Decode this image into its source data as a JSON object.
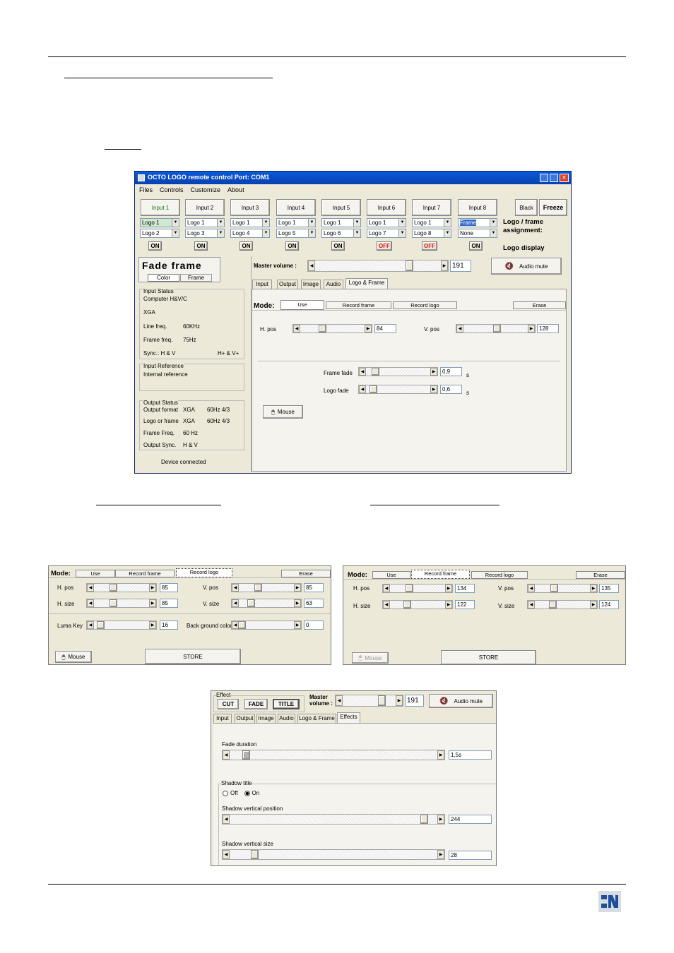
{
  "main": {
    "title": "OCTO LOGO remote control  Port: COM1",
    "menu": [
      "Files",
      "Controls",
      "Customize",
      "About"
    ],
    "inputs": [
      "Input 1",
      "Input 2",
      "Input 3",
      "Input 4",
      "Input 5",
      "Input 6",
      "Input 7",
      "Input 8"
    ],
    "black": "Black",
    "freeze": "Freeze",
    "logo_row1": [
      "Logo 1",
      "Logo 1",
      "Logo 1",
      "Logo 1",
      "Logo 1",
      "Logo 1",
      "Logo 1",
      "Frame"
    ],
    "logo_row2": [
      "Logo 2",
      "Logo 3",
      "Logo 4",
      "Logo 5",
      "Logo 6",
      "Logo 7",
      "Logo 8",
      "None"
    ],
    "assignment": "Logo / frame assignment:",
    "onoff": [
      "ON",
      "ON",
      "ON",
      "ON",
      "ON",
      "OFF",
      "OFF",
      "ON"
    ],
    "logo_display": "Logo display",
    "fade_frame": "Fade frame",
    "color": "Color",
    "frame": "Frame",
    "input_status": {
      "title": "Input Status",
      "line1": "Computer H&V/C",
      "line2": "XGA",
      "line_freq_l": "Line freq.",
      "line_freq": "60KHz",
      "frame_freq_l": "Frame freq.",
      "frame_freq": "75Hz",
      "sync_l": "Sync.:  H & V",
      "sync": "H+ & V+"
    },
    "input_ref": {
      "title": "Input Reference",
      "value": "Internal reference"
    },
    "output_status": {
      "title": "Output Status",
      "r1l": "Output format",
      "r1a": "XGA",
      "r1b": "60Hz  4/3",
      "r2l": "Logo or frame",
      "r2a": "XGA",
      "r2b": "60Hz  4/3",
      "r3l": "Frame Freq.",
      "r3a": "60 Hz",
      "r4l": "Output Sync.",
      "r4a": "H & V"
    },
    "device": "Device connected",
    "master_volume": "Master volume :",
    "volume": "191",
    "audio_mute": "Audio mute",
    "tabs": [
      "Input",
      "Output",
      "Image",
      "Audio",
      "Logo & Frame"
    ],
    "mode": "Mode:",
    "use": "Use",
    "record_frame": "Record frame",
    "record_logo": "Record logo",
    "erase": "Erase",
    "hpos_l": "H. pos",
    "hpos": "84",
    "vpos_l": "V. pos",
    "vpos": "128",
    "frame_fade_l": "Frame fade",
    "frame_fade": "0,9",
    "logo_fade_l": "Logo fade",
    "logo_fade": "0,6",
    "s": "s",
    "mouse": "Mouse"
  },
  "left": {
    "mode": "Mode:",
    "use": "Use",
    "record_frame": "Record frame",
    "record_logo": "Record logo",
    "erase": "Erase",
    "hpos_l": "H. pos",
    "hpos": "85",
    "vpos_l": "V. pos",
    "vpos": "85",
    "hsize_l": "H. size",
    "hsize": "85",
    "vsize_l": "V. size",
    "vsize": "63",
    "luma_l": "Luma Key",
    "luma": "16",
    "bg_l": "Back ground color",
    "bg": "0",
    "mouse": "Mouse",
    "store": "STORE"
  },
  "right": {
    "mode": "Mode:",
    "use": "Use",
    "record_frame": "Record frame",
    "record_logo": "Record logo",
    "erase": "Erase",
    "hpos_l": "H. pos",
    "hpos": "134",
    "vpos_l": "V. pos",
    "vpos": "135",
    "hsize_l": "H. size",
    "hsize": "122",
    "vsize_l": "V. size",
    "vsize": "124",
    "mouse": "Mouse",
    "store": "STORE"
  },
  "effects": {
    "effect": "Effect",
    "cut": "CUT",
    "fade": "FADE",
    "title": "TITLE",
    "master": "Master volume :",
    "volume": "191",
    "audio_mute": "Audio mute",
    "tabs": [
      "Input",
      "Output",
      "Image",
      "Audio",
      "Logo & Frame",
      "Effects"
    ],
    "fade_duration_l": "Fade duration",
    "fade_duration": "1,5s",
    "shadow_title": "Shadow title",
    "off": "Off",
    "on": "On",
    "svp_l": "Shadow vertical position",
    "svp": "244",
    "svs_l": "Shadow vertical size",
    "svs": "28"
  }
}
